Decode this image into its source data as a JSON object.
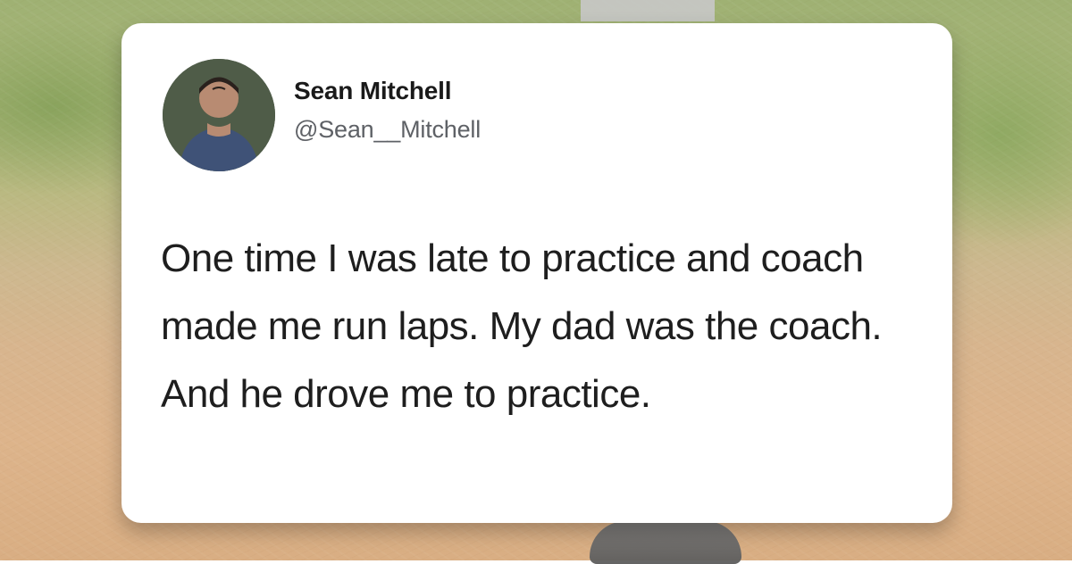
{
  "tweet": {
    "display_name": "Sean Mitchell",
    "handle": "@Sean__Mitchell",
    "text": "One time I was late to practice and coach made me run laps. My dad was the coach. And he drove me to practice."
  },
  "icons": {
    "avatar": "profile-photo"
  }
}
